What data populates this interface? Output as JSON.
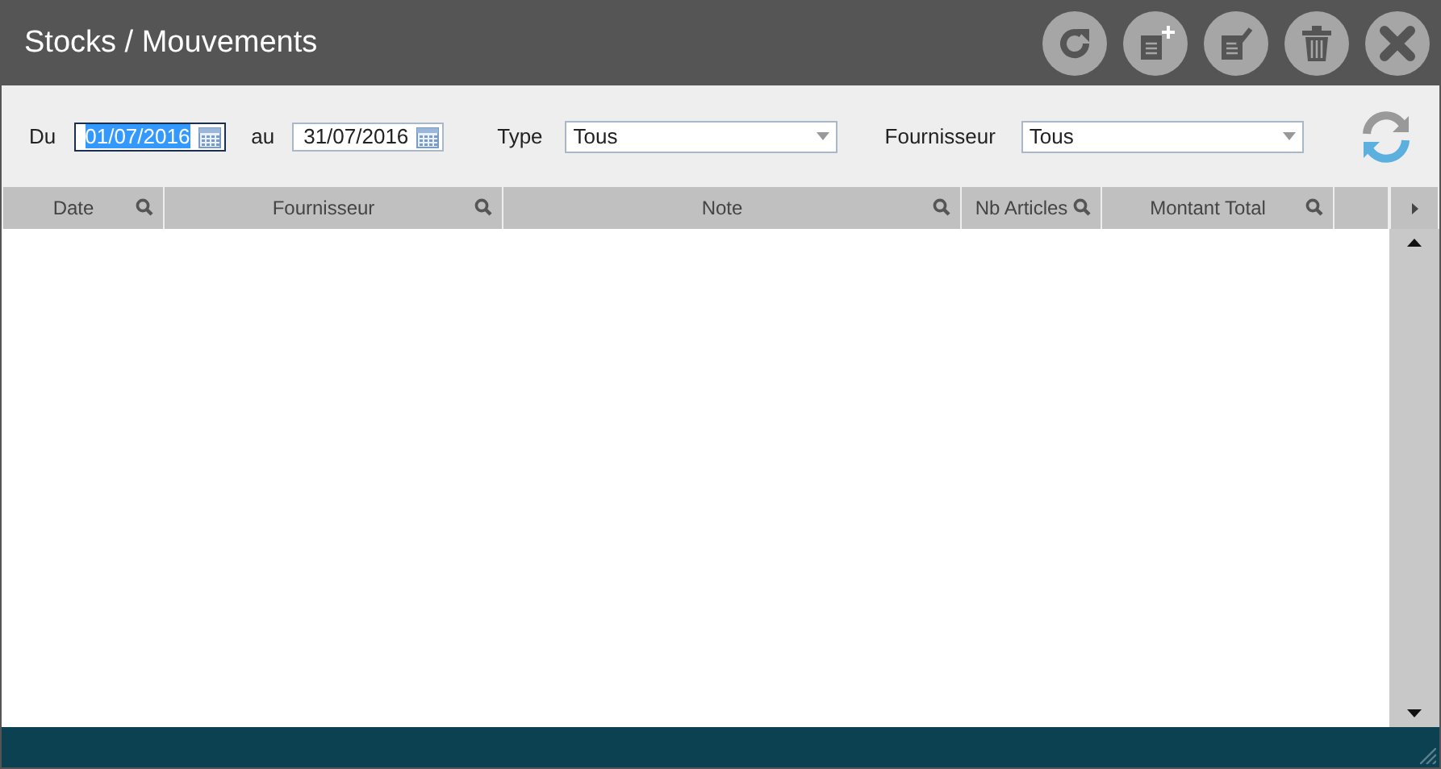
{
  "window": {
    "title": "Stocks / Mouvements"
  },
  "filters": {
    "from_label": "Du",
    "from_value": "01/07/2016",
    "from_focused": true,
    "to_label": "au",
    "to_value": "31/07/2016",
    "to_focused": false,
    "type_label": "Type",
    "type_value": "Tous",
    "supplier_label": "Fournisseur",
    "supplier_value": "Tous"
  },
  "table": {
    "columns": [
      {
        "label": "Date",
        "searchable": true
      },
      {
        "label": "Fournisseur",
        "searchable": true
      },
      {
        "label": "Note",
        "searchable": true
      },
      {
        "label": "Nb Articles",
        "searchable": true
      },
      {
        "label": "Montant Total",
        "searchable": true
      }
    ]
  }
}
